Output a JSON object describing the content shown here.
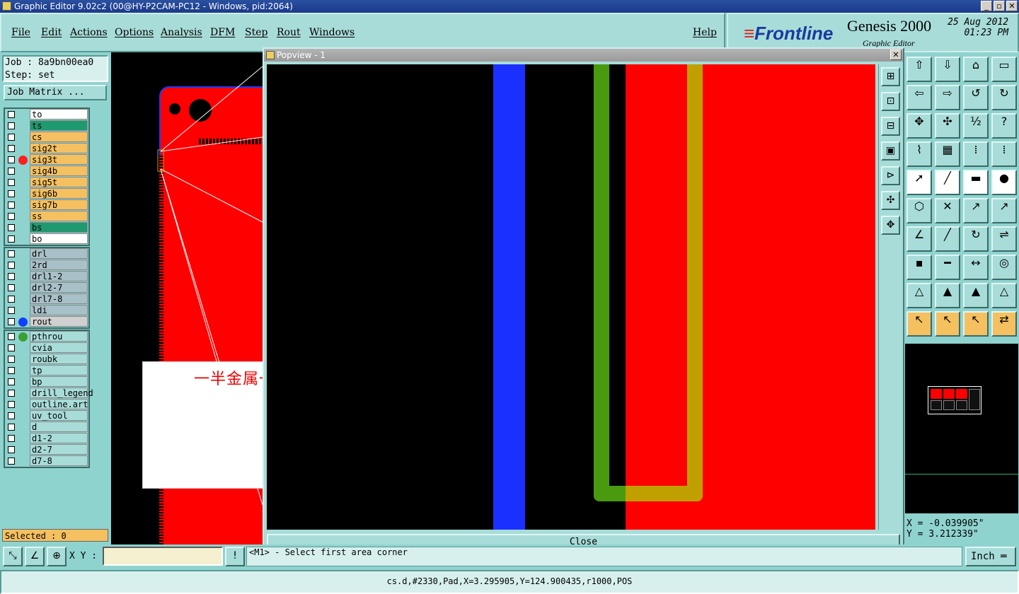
{
  "window": {
    "title": "Graphic Editor 9.02c2 (00@HY-P2CAM-PC12 - Windows, pid:2064)",
    "min": "_",
    "max": "▫",
    "close": "✕"
  },
  "menu": {
    "file": "File",
    "edit": "Edit",
    "actions": "Actions",
    "options": "Options",
    "analysis": "Analysis",
    "dfm": "DFM",
    "step": "Step",
    "rout": "Rout",
    "windows": "Windows",
    "help": "Help"
  },
  "brand": {
    "logo": "Frontline",
    "product": "Genesis 2000",
    "subtitle": "Graphic Editor",
    "date": "25 Aug 2012",
    "time": "01:23 PM"
  },
  "job": {
    "job_line": "Job : 8a9bn00ea0",
    "step_line": "Step: set",
    "matrix_button": "Job Matrix ..."
  },
  "layers_board": [
    {
      "name": "to",
      "bg": "#ffffff"
    },
    {
      "name": "ts",
      "bg": "#1f9a70"
    },
    {
      "name": "cs",
      "bg": "#f5c060"
    },
    {
      "name": "sig2t",
      "bg": "#f5c060"
    },
    {
      "name": "sig3t",
      "bg": "#f5c060",
      "dot": "#ff2020"
    },
    {
      "name": "sig4b",
      "bg": "#f5c060"
    },
    {
      "name": "sig5t",
      "bg": "#f5c060"
    },
    {
      "name": "sig6b",
      "bg": "#f5c060"
    },
    {
      "name": "sig7b",
      "bg": "#f5c060"
    },
    {
      "name": "ss",
      "bg": "#f5c060"
    },
    {
      "name": "bs",
      "bg": "#1f9a70"
    },
    {
      "name": "bo",
      "bg": "#ffffff"
    }
  ],
  "layers_drill": [
    {
      "name": "drl",
      "bg": "#a8c0c8"
    },
    {
      "name": "2rd",
      "bg": "#a8c0c8"
    },
    {
      "name": "drl1-2",
      "bg": "#a8c0c8"
    },
    {
      "name": "drl2-7",
      "bg": "#a8c0c8"
    },
    {
      "name": "drl7-8",
      "bg": "#a8c0c8"
    },
    {
      "name": "ldi",
      "bg": "#a8c0c8"
    },
    {
      "name": "rout",
      "bg": "#d0d0d0",
      "dot": "#1040ff"
    }
  ],
  "layers_misc": [
    {
      "name": "pthrou",
      "bg": "#a8dcd8",
      "dot": "#3aa030"
    },
    {
      "name": "cvia",
      "bg": "#a8dcd8"
    },
    {
      "name": "roubk",
      "bg": "#a8dcd8"
    },
    {
      "name": "tp",
      "bg": "#a8dcd8"
    },
    {
      "name": "bp",
      "bg": "#a8dcd8"
    },
    {
      "name": "drill_legend",
      "bg": "#a8dcd8"
    },
    {
      "name": "outline.art",
      "bg": "#a8dcd8"
    },
    {
      "name": "uv_tool",
      "bg": "#a8dcd8"
    },
    {
      "name": "d",
      "bg": "#a8dcd8"
    },
    {
      "name": "d1-2",
      "bg": "#a8dcd8"
    },
    {
      "name": "d2-7",
      "bg": "#a8dcd8"
    },
    {
      "name": "d7-8",
      "bg": "#a8dcd8"
    }
  ],
  "selected": "Selected : 0",
  "note": {
    "text": "一半金属一半非金属？？"
  },
  "popview": {
    "title": "Popview - 1",
    "close_button": "Close"
  },
  "coords": {
    "x": "X = -0.039905\"",
    "y": "Y = 3.212339\""
  },
  "bottom": {
    "xy_label": "X Y :",
    "prompt": "<M1> - Select first area corner",
    "units": "Inch ═"
  },
  "status": "cs.d,#2330,Pad,X=3.295905,Y=124.900435,r1000,POS",
  "colors": {
    "copper": "#ff0000",
    "rout": "#1a30ff",
    "green": "#4a9a10",
    "gold": "#c0a000"
  }
}
